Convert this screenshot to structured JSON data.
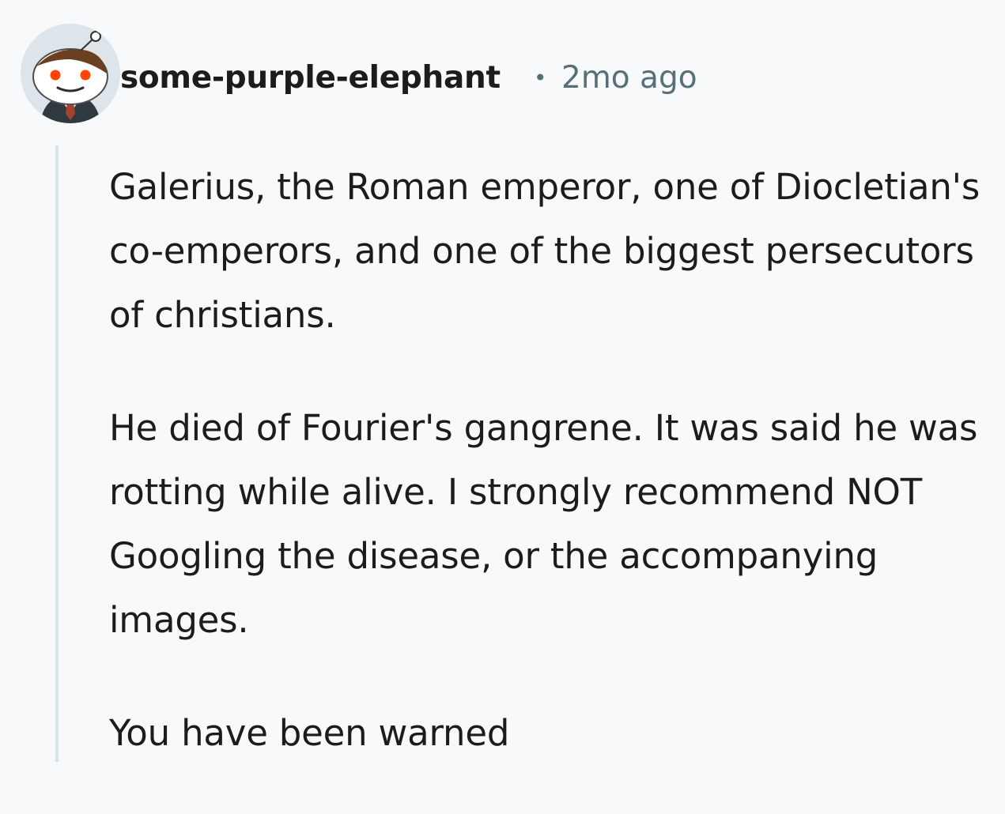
{
  "comment": {
    "username": "some-purple-elephant",
    "separator": "•",
    "timestamp": "2mo ago",
    "avatar_icon": "reddit-snoo-avatar-icon",
    "paragraphs": [
      "Galerius, the Roman emperor, one of Diocletian's co-emperors, and one of the biggest persecutors of christians.",
      "He died of Fourier's gangrene. It was said he was rotting while alive. I strongly recommend NOT Googling the disease, or the accompanying images.",
      "You have been warned"
    ]
  },
  "colors": {
    "background": "#f7f9fa",
    "text": "#1c1c1c",
    "meta": "#576f76",
    "thread_line": "#d7e3ea"
  }
}
